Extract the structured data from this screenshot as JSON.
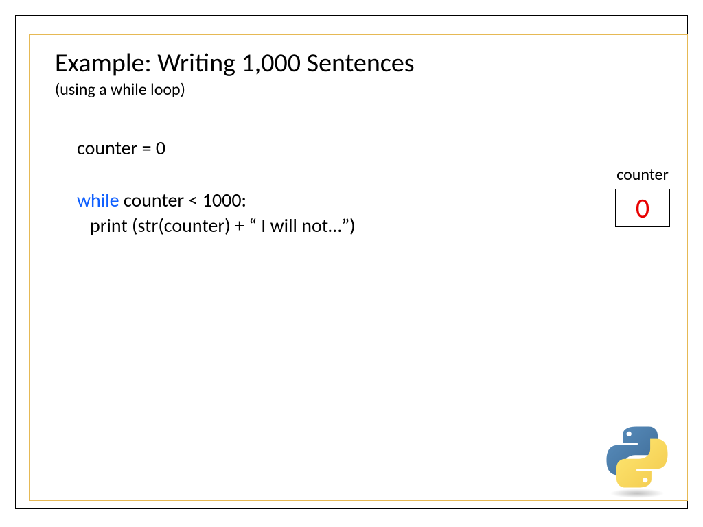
{
  "title": "Example: Writing 1,000 Sentences",
  "subtitle": "(using a while loop)",
  "code": {
    "line1": "counter = 0",
    "kw_while": "while",
    "line2_rest": " counter < 1000:",
    "line3": "   print (str(counter) + “ I will not…”)"
  },
  "counter": {
    "label": "counter",
    "value": "0"
  },
  "colors": {
    "keyword": "#1060ff",
    "counter_value": "#e80000",
    "inner_border": "#e6b955"
  }
}
